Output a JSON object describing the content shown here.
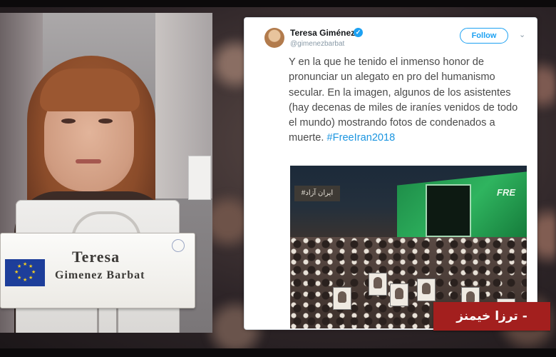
{
  "nameplate": {
    "first_name": "Teresa",
    "last_name": "Gimenez Barbat"
  },
  "tweet": {
    "author_name": "Teresa Giménez",
    "author_handle": "@gimenezbarbat",
    "follow_label": "Follow",
    "menu_glyph": "⌄",
    "verified_glyph": "✓",
    "text": "Y en la que he tenido el inmenso honor de pronunciar un alegato en pro del humanismo secular. En la imagen, algunos de los asistentes (hay decenas de miles de iraníes venidos de todo el mundo) mostrando fotos de condenados a muerte.",
    "hashtag": "#FreeIran2018",
    "image": {
      "banner_text": "#ایران آزاد",
      "stage_text": "FRE"
    }
  },
  "caption": {
    "text": "- ترزا خیمنز"
  },
  "colors": {
    "caption_bg": "#a31f1e",
    "link_blue": "#1b95e0",
    "twitter_blue": "#1da1f2"
  }
}
